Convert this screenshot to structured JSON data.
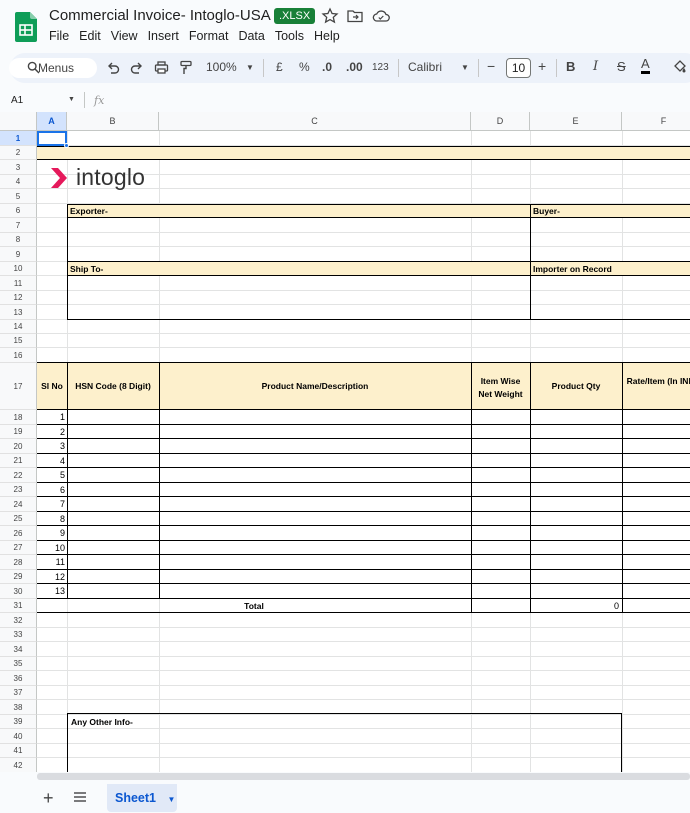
{
  "title_bar": {
    "doc_title": "Commercial Invoice- Intoglo-USA",
    "file_badge": ".XLSX"
  },
  "menu": [
    "File",
    "Edit",
    "View",
    "Insert",
    "Format",
    "Data",
    "Tools",
    "Help"
  ],
  "toolbar": {
    "search_label": "Menus",
    "zoom": "100%",
    "currency": "£",
    "percent": "%",
    "decimal_decrease": ".0",
    "decimal_increase": ".00",
    "number_format": "123",
    "font_family": "Calibri",
    "font_size": "10",
    "bold": "B",
    "italic": "I",
    "strike": "S",
    "text_color": "A"
  },
  "formula_bar": {
    "name_box": "A1",
    "fx": "fx"
  },
  "columns": [
    "A",
    "B",
    "C",
    "D",
    "E",
    "F"
  ],
  "rows": [
    "1",
    "2",
    "3",
    "4",
    "5",
    "6",
    "7",
    "8",
    "9",
    "10",
    "11",
    "12",
    "13",
    "14",
    "15",
    "16",
    "17",
    "18",
    "19",
    "20",
    "21",
    "22",
    "23",
    "24",
    "25",
    "26",
    "27",
    "28",
    "29",
    "30",
    "31",
    "32",
    "33",
    "34",
    "35",
    "36",
    "37",
    "38",
    "39",
    "40",
    "41",
    "42"
  ],
  "sheet": {
    "logo_text": "intoglo",
    "exporter_label": "Exporter-",
    "buyer_label": "Buyer-",
    "ship_to_label": "Ship To-",
    "importer_label": "Importer on Record",
    "table_headers": {
      "sl_no": "Sl No",
      "hsn": "HSN Code (8 Digit)",
      "product": "Product Name/Description",
      "weight": "Item Wise Net Weight",
      "qty": "Product Qty",
      "rate": "Rate/Item (In INR)"
    },
    "serials": [
      "1",
      "2",
      "3",
      "4",
      "5",
      "6",
      "7",
      "8",
      "9",
      "10",
      "11",
      "12",
      "13"
    ],
    "total_label": "Total",
    "total_qty": "0",
    "other_info_label": "Any Other Info-"
  },
  "tabs": {
    "sheet_name": "Sheet1"
  }
}
